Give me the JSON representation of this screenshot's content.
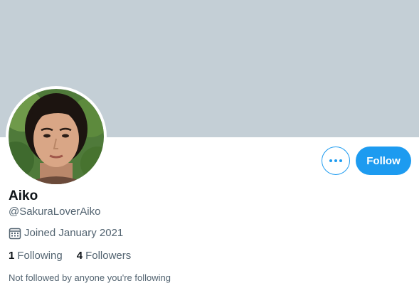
{
  "profile": {
    "display_name": "Aiko",
    "handle": "@SakuraLoverAiko",
    "joined": "Joined January 2021",
    "following_count": "1",
    "following_label": "Following",
    "followers_count": "4",
    "followers_label": "Followers",
    "followed_note": "Not followed by anyone you're following"
  },
  "actions": {
    "follow_label": "Follow",
    "more_icon": "more-horizontal-icon"
  },
  "colors": {
    "banner": "#c4cfd6",
    "accent": "#1d9bf0",
    "text_primary": "#0f1419",
    "text_secondary": "#536471"
  }
}
